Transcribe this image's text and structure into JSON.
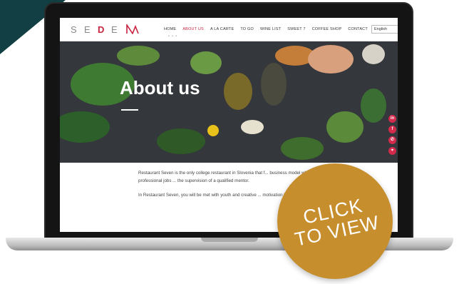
{
  "site": {
    "logo_letters": [
      "S",
      "E",
      "D",
      "E"
    ],
    "nav": [
      "HOME",
      "ABOUT US",
      "A LA CARTE",
      "TO GO",
      "WINE LIST",
      "SWEET 7",
      "COFFEE SHOP",
      "CONTACT"
    ],
    "active_nav": "ABOUT US",
    "nav_dots": "• • •",
    "language": "English"
  },
  "hero": {
    "title": "About us"
  },
  "content": {
    "para1": "Restaurant Seven is the only college restaurant in Slovenia that f... business model where students perform all professional jobs ... the supervision of a qualified mentor.",
    "para2": "In Restaurant Seven, you will be met with youth and creative ... motivation for professional growth and learning"
  },
  "social": [
    "in",
    "f",
    "✆",
    "⌖"
  ],
  "badge": {
    "line1": "CLICK",
    "line2": "TO VIEW"
  },
  "colors": {
    "corner": "#123f43",
    "badge": "#c68e2d",
    "brand_red": "#c9243f"
  }
}
